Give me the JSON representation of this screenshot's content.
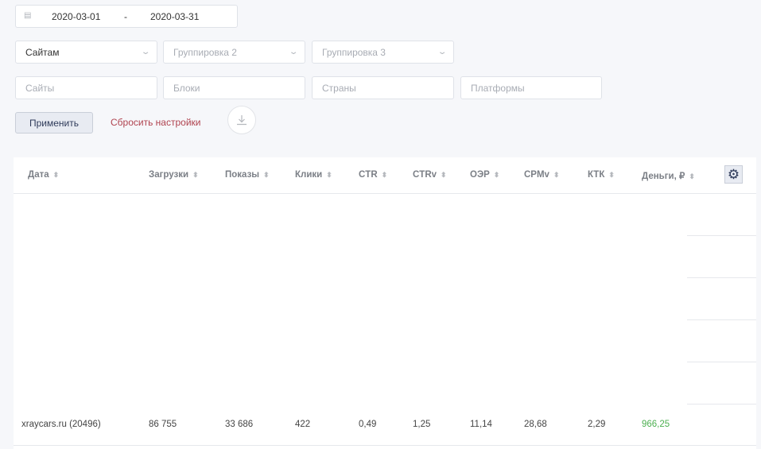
{
  "date_range": {
    "from": "2020-03-01",
    "separator": "-",
    "to": "2020-03-31"
  },
  "groupings": [
    {
      "value": "Сайтам",
      "placeholder": false
    },
    {
      "value": "Группировка 2",
      "placeholder": true
    },
    {
      "value": "Группировка 3",
      "placeholder": true
    }
  ],
  "filters": [
    "Сайты",
    "Блоки",
    "Страны",
    "Платформы"
  ],
  "actions": {
    "apply": "Применить",
    "reset": "Сбросить настройки"
  },
  "table": {
    "columns": [
      "Дата",
      "Загрузки",
      "Показы",
      "Клики",
      "CTR",
      "CTRv",
      "ОЭР",
      "CPMv",
      "КТК",
      "Деньги, ₽"
    ],
    "rows": [
      [
        "xraycars.ru (20496)",
        "86 755",
        "33 686",
        "422",
        "0,49",
        "1,25",
        "11,14",
        "28,68",
        "2,29",
        "966,25"
      ]
    ]
  },
  "colors": {
    "money": "#4caf50",
    "reset": "#b0434f",
    "accent": "#2e3a59"
  }
}
